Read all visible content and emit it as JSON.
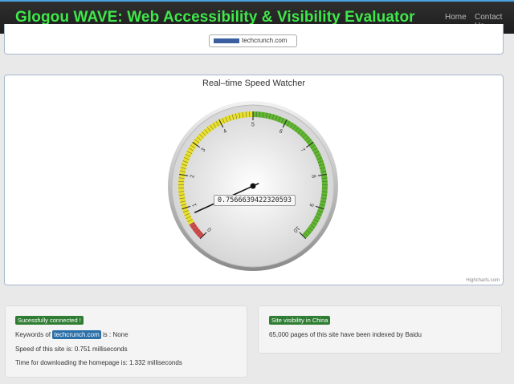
{
  "header": {
    "title": "Glogou WAVE: Web Accessibility & Visibility Evaluator",
    "nav": [
      "Home",
      "Contact Us"
    ],
    "colors": {
      "title": "#3fe84a",
      "bar": "#222222"
    }
  },
  "search": {
    "url": "techcrunch.com"
  },
  "gauge": {
    "title": "Real–time Speed Watcher",
    "value_label": "0.7566639422320593",
    "value": 0.757,
    "min": 0,
    "max": 10,
    "tick_labels": [
      "0",
      "1",
      "2",
      "3",
      "4",
      "5",
      "6",
      "7",
      "8",
      "9",
      "10"
    ],
    "bands": [
      {
        "from": 0,
        "to": 0.5,
        "color": "#d24a4a"
      },
      {
        "from": 0.5,
        "to": 5,
        "color": "#e8e02a"
      },
      {
        "from": 5,
        "to": 10,
        "color": "#5fb82e"
      }
    ],
    "credits": "Highcharts.com"
  },
  "status": {
    "badge": "Sucessfully connected !",
    "keywords_prefix": "Keywords of",
    "keywords_site": "techcrunch.com",
    "keywords_suffix": "is : None",
    "speed": "Speed of this site is: 0.751 milliseconds",
    "download": "Time for downloading the homepage is: 1.332 milliseconds"
  },
  "visibility": {
    "badge": "Site visibility in China",
    "text": "65,000 pages of this site have been indexed by Baidu"
  }
}
